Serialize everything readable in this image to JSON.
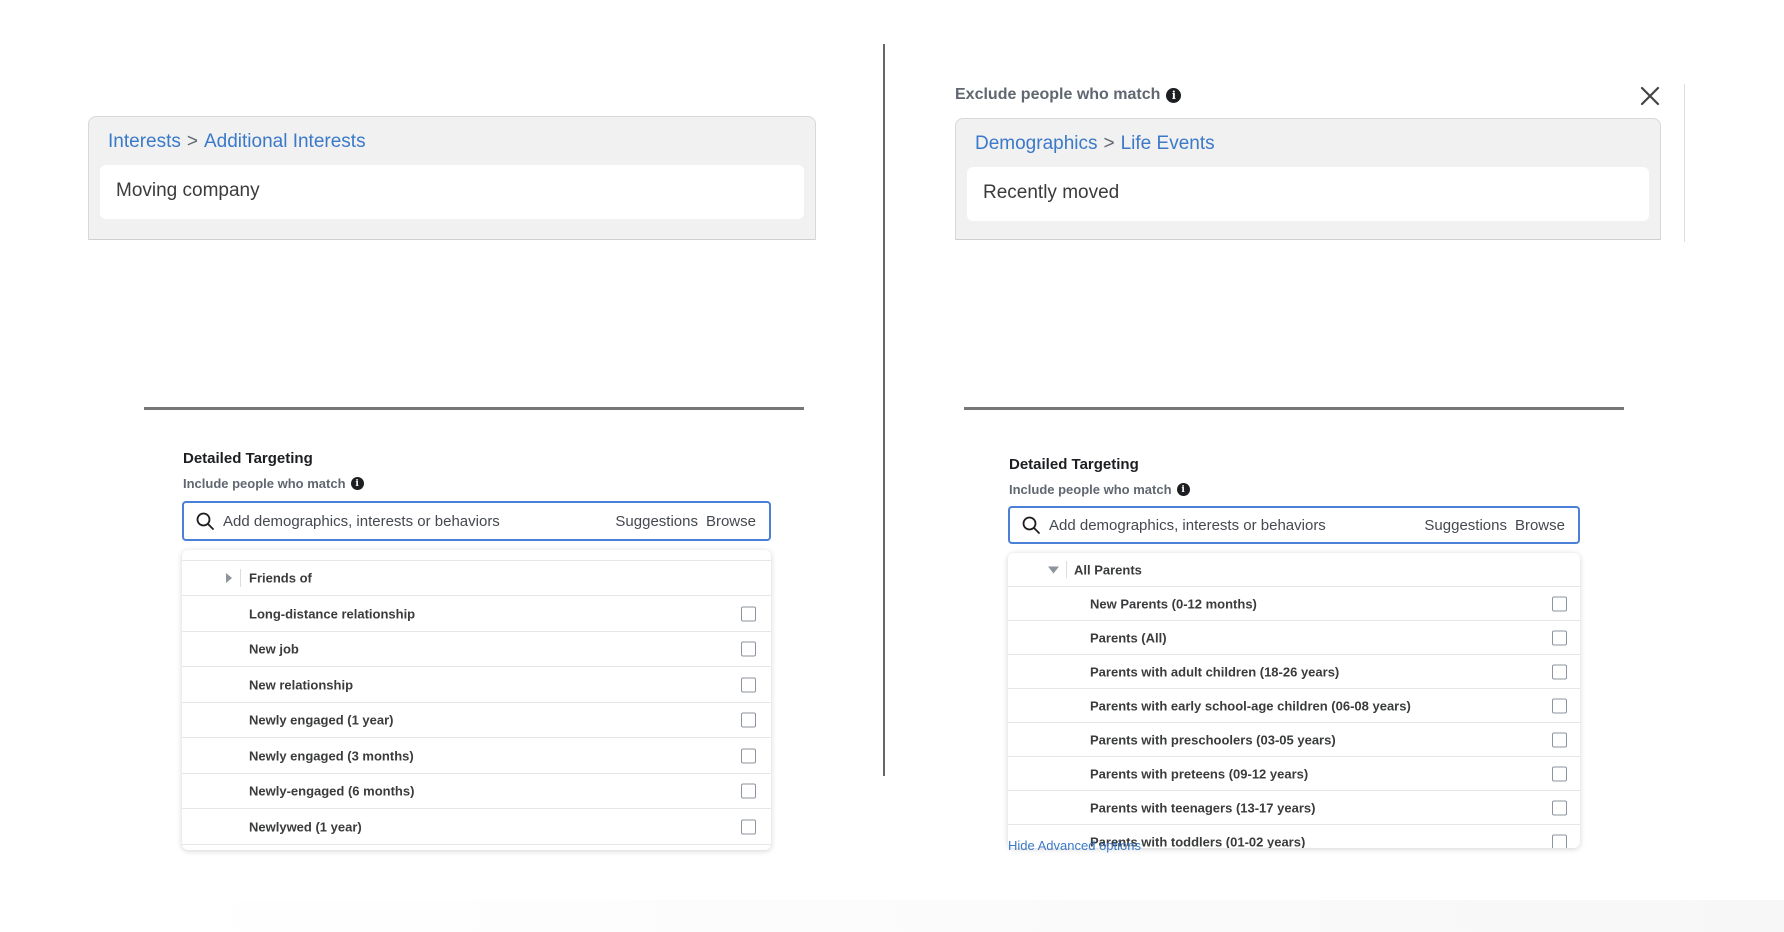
{
  "left": {
    "breadcrumb": {
      "part1": "Interests",
      "separator": ">",
      "part2": "Additional Interests"
    },
    "selected_value": "Moving company",
    "targeting": {
      "title": "Detailed Targeting",
      "subtitle": "Include people who match",
      "search_placeholder": "Add demographics, interests or behaviors",
      "suggestions_label": "Suggestions",
      "browse_label": "Browse",
      "expandable_item": "Friends of",
      "items": [
        "Long-distance relationship",
        "New job",
        "New relationship",
        "Newly engaged (1 year)",
        "Newly engaged (3 months)",
        "Newly-engaged (6 months)",
        "Newlywed (1 year)"
      ]
    }
  },
  "right": {
    "exclude_label": "Exclude people who match",
    "breadcrumb": {
      "part1": "Demographics",
      "separator": ">",
      "part2": "Life Events"
    },
    "selected_value": "Recently moved",
    "targeting": {
      "title": "Detailed Targeting",
      "subtitle": "Include people who match",
      "search_placeholder": "Add demographics, interests or behaviors",
      "suggestions_label": "Suggestions",
      "browse_label": "Browse",
      "group_label": "All Parents",
      "items": [
        "New Parents (0-12 months)",
        "Parents (All)",
        "Parents with adult children (18-26 years)",
        "Parents with early school-age children (06-08 years)",
        "Parents with preschoolers (03-05 years)",
        "Parents with preteens (09-12 years)",
        "Parents with teenagers (13-17 years)",
        "Parents with toddlers (01-02 years)"
      ],
      "hide_advanced": "Hide Advanced options"
    }
  },
  "icons": [
    "info-icon",
    "close-icon",
    "search-icon",
    "chevron-right-icon",
    "chevron-down-icon",
    "checkbox"
  ],
  "colors": {
    "link_blue": "#3b79c9",
    "input_border": "#4a80d6",
    "card_bg": "#f1f1f1"
  }
}
